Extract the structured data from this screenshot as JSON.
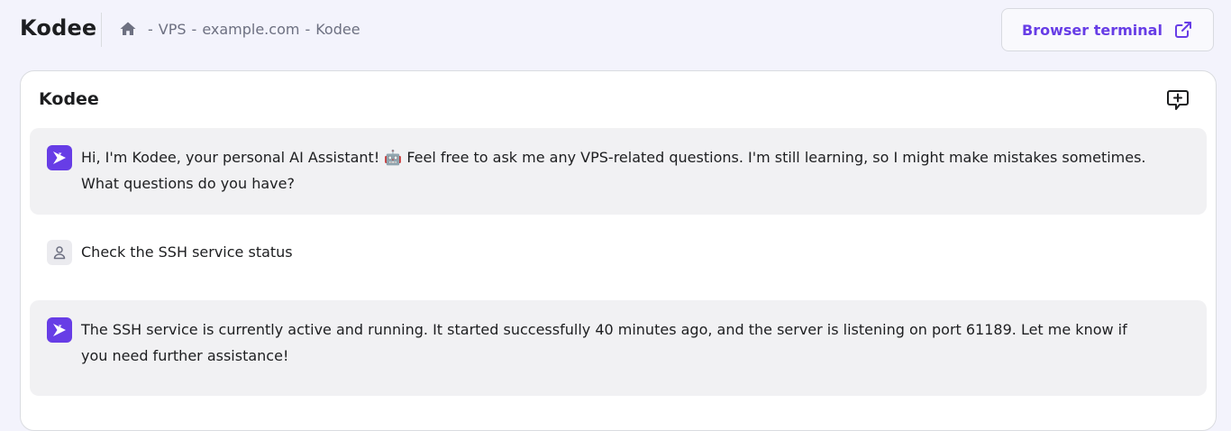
{
  "header": {
    "title": "Kodee",
    "breadcrumb": {
      "home_icon": "home-icon",
      "separator": "-",
      "items": [
        "VPS",
        "example.com",
        "Kodee"
      ]
    },
    "terminal_button": {
      "label": "Browser terminal",
      "icon": "external-link-icon"
    }
  },
  "panel": {
    "title": "Kodee",
    "new_chat_icon": "chat-plus-icon",
    "messages": [
      {
        "role": "assistant",
        "text": "Hi, I'm Kodee, your personal AI Assistant! 🤖 Feel free to ask me any VPS-related questions. I'm still learning, so I might make mistakes sometimes. What questions do you have?"
      },
      {
        "role": "user",
        "text": "Check the SSH service status"
      },
      {
        "role": "assistant",
        "text": "The SSH service is currently active and running. It started successfully 40 minutes ago, and the server is listening on port 61189. Let me know if you need further assistance!"
      }
    ]
  },
  "colors": {
    "page_background": "#f3f3fc",
    "accent": "#673de6",
    "assistant_bubble": "#f1f1f3",
    "muted_text": "#6d7081"
  }
}
